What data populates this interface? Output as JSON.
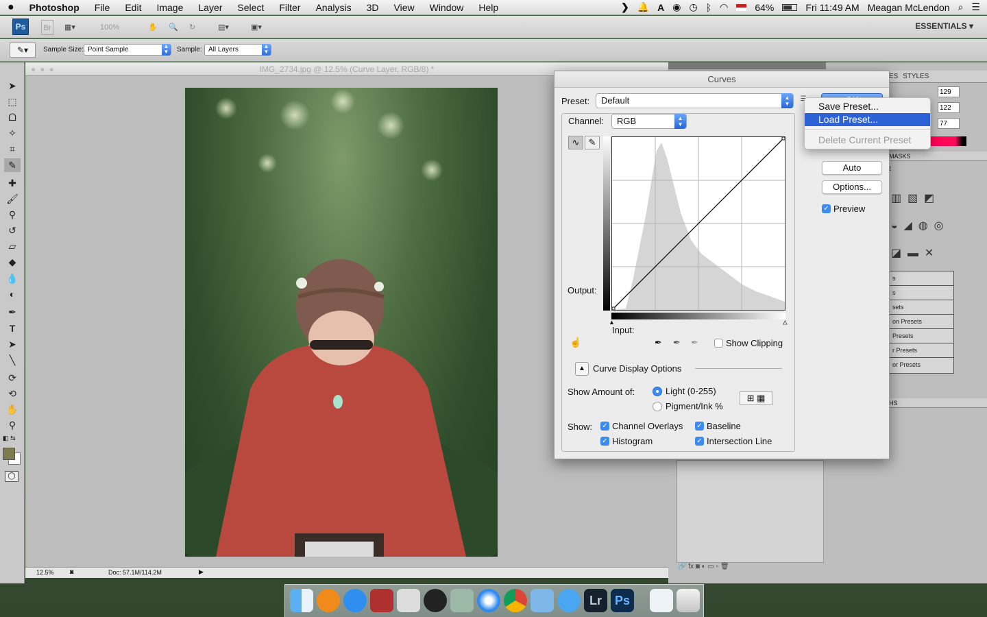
{
  "menubar": {
    "apple": "",
    "app": "Photoshop",
    "items": [
      "File",
      "Edit",
      "Image",
      "Layer",
      "Select",
      "Filter",
      "Analysis",
      "3D",
      "View",
      "Window",
      "Help"
    ],
    "battery": "64%",
    "clock": "Fri 11:49 AM",
    "user": "Meagan McLendon"
  },
  "appbar": {
    "ps_logo": "Ps",
    "bridge": "Br",
    "zoom": "100%",
    "workspace": "ESSENTIALS ▾"
  },
  "options": {
    "sample_size_label": "Sample Size:",
    "sample_size_value": "Point Sample",
    "sample_label": "Sample:",
    "sample_value": "All Layers"
  },
  "document": {
    "title": "IMG_2734.jpg @ 12.5% (Curve Layer, RGB/8) *",
    "zoom": "12.5%",
    "doc_size": "Doc: 57.1M/114.2M"
  },
  "panels": {
    "tabs": [
      "ES",
      "STYLES"
    ],
    "rgb_values": [
      "129",
      "122",
      "77"
    ],
    "masks_tab": "MASKS",
    "adjust_letter": "t",
    "preset_list": [
      "s",
      "s",
      "sets",
      "on Presets",
      "Presets",
      "r Presets",
      "or Presets"
    ],
    "paths_tab": "HS"
  },
  "curves": {
    "title": "Curves",
    "preset_label": "Preset:",
    "preset_value": "Default",
    "channel_label": "Channel:",
    "channel_value": "RGB",
    "output_label": "Output:",
    "input_label": "Input:",
    "show_clipping": "Show Clipping",
    "ok_label": "OK",
    "auto": "Auto",
    "options": "Options...",
    "preview": "Preview",
    "display_options": "Curve Display Options",
    "show_amount_label": "Show Amount of:",
    "light": "Light  (0-255)",
    "pigment": "Pigment/Ink %",
    "show_label": "Show:",
    "channel_overlays": "Channel Overlays",
    "baseline": "Baseline",
    "histogram": "Histogram",
    "intersection_line": "Intersection Line"
  },
  "preset_menu": {
    "save": "Save Preset...",
    "load": "Load Preset...",
    "delete": "Delete Current Preset"
  },
  "colors": {
    "foreground": "#807a4f",
    "background": "#ffffff",
    "accent": "#3c8cf0",
    "menu_highlight": "#2c62d6"
  }
}
